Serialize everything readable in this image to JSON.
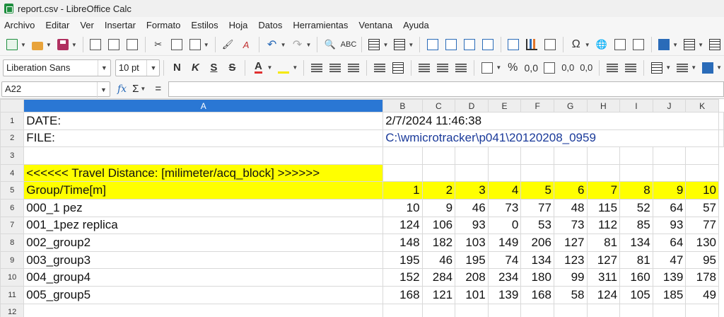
{
  "window": {
    "title": "report.csv - LibreOffice Calc"
  },
  "menu": [
    "Archivo",
    "Editar",
    "Ver",
    "Insertar",
    "Formato",
    "Estilos",
    "Hoja",
    "Datos",
    "Herramientas",
    "Ventana",
    "Ayuda"
  ],
  "toolbar": {
    "font_name": "Liberation Sans",
    "font_size": "10 pt",
    "bold": "N",
    "italic": "K",
    "underline": "S",
    "strike": "S",
    "percent": "%",
    "decimal": "0,0",
    "sigma": "Ω"
  },
  "formula_bar": {
    "cell_ref": "A22",
    "fx": "fx",
    "sigma": "Σ",
    "equals": "=",
    "content": ""
  },
  "columns": [
    "A",
    "B",
    "C",
    "D",
    "E",
    "F",
    "G",
    "H",
    "I",
    "J",
    "K"
  ],
  "rows": [
    {
      "num": "1",
      "a": "DATE:",
      "b": "2/7/2024 11:46:38",
      "vals": []
    },
    {
      "num": "2",
      "a": "FILE:",
      "b": "C:\\wmicrotracker\\p041\\20120208_0959",
      "vals": []
    },
    {
      "num": "3",
      "a": "",
      "b": "",
      "vals": []
    },
    {
      "num": "4",
      "a": "<<<<<< Travel Distance: [milimeter/acq_block] >>>>>>",
      "b": "",
      "vals": []
    },
    {
      "num": "5",
      "a": "Group/Time[m]",
      "b": "",
      "vals": [
        "1",
        "2",
        "3",
        "4",
        "5",
        "6",
        "7",
        "8",
        "9",
        "10"
      ]
    },
    {
      "num": "6",
      "a": "000_1 pez",
      "b": "",
      "vals": [
        "10",
        "9",
        "46",
        "73",
        "77",
        "48",
        "115",
        "52",
        "64",
        "57"
      ]
    },
    {
      "num": "7",
      "a": "001_1pez replica",
      "b": "",
      "vals": [
        "124",
        "106",
        "93",
        "0",
        "53",
        "73",
        "112",
        "85",
        "93",
        "77"
      ]
    },
    {
      "num": "8",
      "a": "002_group2",
      "b": "",
      "vals": [
        "148",
        "182",
        "103",
        "149",
        "206",
        "127",
        "81",
        "134",
        "64",
        "130"
      ]
    },
    {
      "num": "9",
      "a": "003_group3",
      "b": "",
      "vals": [
        "195",
        "46",
        "195",
        "74",
        "134",
        "123",
        "127",
        "81",
        "47",
        "95"
      ]
    },
    {
      "num": "10",
      "a": "004_group4",
      "b": "",
      "vals": [
        "152",
        "284",
        "208",
        "234",
        "180",
        "99",
        "311",
        "160",
        "139",
        "178"
      ]
    },
    {
      "num": "11",
      "a": "005_group5",
      "b": "",
      "vals": [
        "168",
        "121",
        "101",
        "139",
        "168",
        "58",
        "124",
        "105",
        "185",
        "49"
      ]
    },
    {
      "num": "12",
      "a": "",
      "b": "",
      "vals": []
    }
  ],
  "colors": {
    "selected_header": "#2a77d4",
    "highlight": "#ffff00",
    "link": "#1a3a9a"
  }
}
